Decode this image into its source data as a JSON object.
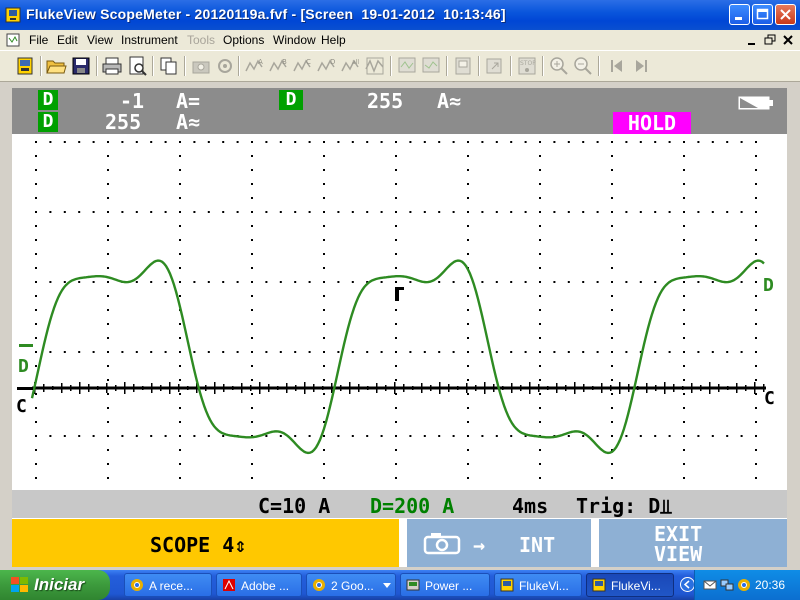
{
  "window": {
    "title": "FlukeView ScopeMeter - 20120119a.fvf - [Screen  19-01-2012  10:13:46]"
  },
  "menu": {
    "items": [
      "File",
      "Edit",
      "View",
      "Instrument",
      "Tools",
      "Options",
      "Window",
      "Help"
    ],
    "disabled": [
      "Tools"
    ]
  },
  "toolbar": {
    "buttons": [
      "instrument-connect",
      "open",
      "save",
      "print",
      "print-preview",
      "copy",
      "camera",
      "record",
      "meter-a",
      "meter-b",
      "meter-c",
      "meter-d",
      "meter-all",
      "scope-read",
      "scope-read-2",
      "scope-compare",
      "scope-export",
      "stop",
      "zoom-in",
      "zoom-out",
      "first",
      "last"
    ]
  },
  "scope": {
    "readout": {
      "ch_d_tag1": "D",
      "ch_d_tag2": "D",
      "ch_d_tag3": "D",
      "val1": "-1",
      "unit1": "A=",
      "val2": "255",
      "unit2": "A≈",
      "val3": "255",
      "unit3": "A≈",
      "hold": "HOLD"
    },
    "markers": {
      "left_d": "D",
      "left_c": "C",
      "right_c": "C",
      "right_d": "D"
    },
    "status": {
      "c_range": "C=10 A",
      "d_range": "D=200 A",
      "timebase": "4ms",
      "trigger": "Trig: D⫫"
    },
    "softkeys": {
      "f1": "SCOPE 4⇕",
      "f2_arrow": "→",
      "f2": "INT",
      "f3_line1": "EXIT",
      "f3_line2": "VIEW"
    },
    "colors": {
      "trace_d": "#2e8b22",
      "trace_c": "#000000",
      "hold": "#ff00ff",
      "f1": "#ffc800",
      "f2": "#8eb0d4"
    }
  },
  "taskbar": {
    "start": "Iniciar",
    "tasks": [
      {
        "label": "A rece...",
        "icon": "chrome-icon"
      },
      {
        "label": "Adobe ...",
        "icon": "acrobat-icon"
      },
      {
        "label": "2 Goo...",
        "icon": "chrome-icon"
      },
      {
        "label": "Power ...",
        "icon": "app-icon"
      },
      {
        "label": "FlukeVi...",
        "icon": "flukeview-icon"
      },
      {
        "label": "FlukeVi...",
        "icon": "flukeview-icon"
      }
    ],
    "clock": "20:36"
  }
}
